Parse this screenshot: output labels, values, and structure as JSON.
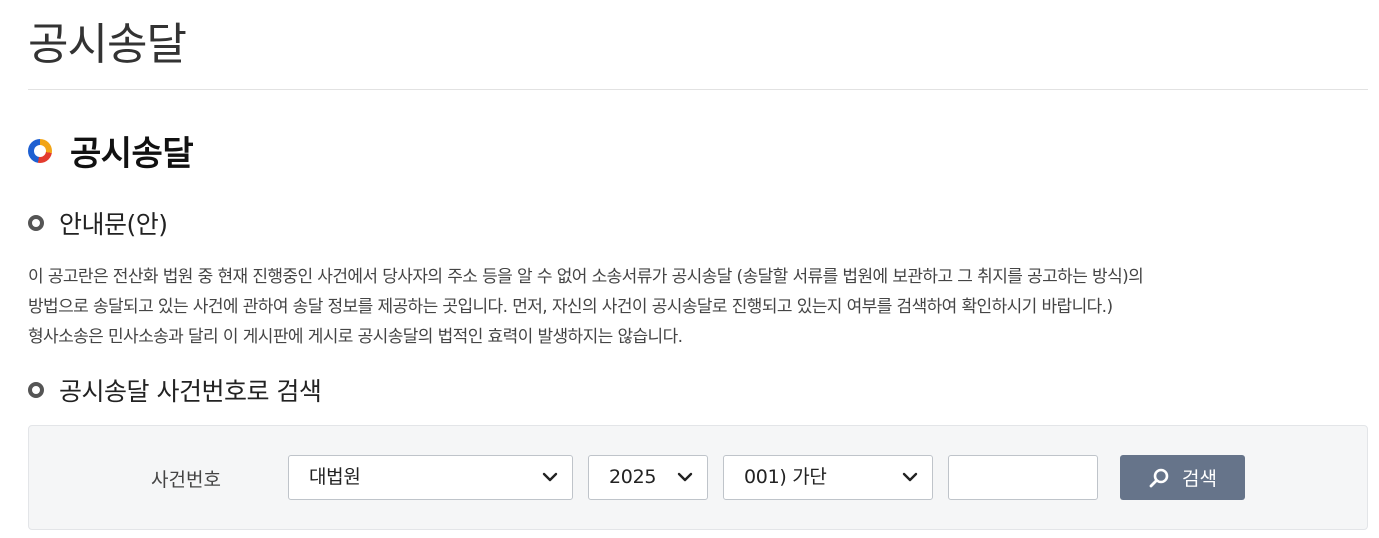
{
  "page": {
    "title": "공시송달"
  },
  "section": {
    "title": "공시송달"
  },
  "guide": {
    "title": "안내문(안)",
    "lines": [
      "이 공고란은 전산화 법원 중 현재 진행중인 사건에서 당사자의 주소 등을 알 수 없어 소송서류가 공시송달 (송달할 서류를 법원에 보관하고 그 취지를 공고하는 방식)의",
      "방법으로 송달되고 있는 사건에 관하여 송달 정보를 제공하는 곳입니다. 먼저, 자신의 사건이 공시송달로 진행되고 있는지 여부를 검색하여 확인하시기 바랍니다.)",
      "형사소송은 민사소송과 달리 이 게시판에 게시로 공시송달의 법적인 효력이 발생하지는 않습니다."
    ]
  },
  "search": {
    "title": "공시송달 사건번호로 검색",
    "label": "사건번호",
    "court": "대법원",
    "year": "2025",
    "case_type": "001) 가단",
    "case_number": "",
    "button_label": "검색",
    "button_icon": "search-icon"
  },
  "colors": {
    "button_bg": "#66748a",
    "ring_orange": "#f2a516",
    "ring_red": "#e33b2e",
    "ring_blue": "#1d5fd1"
  }
}
